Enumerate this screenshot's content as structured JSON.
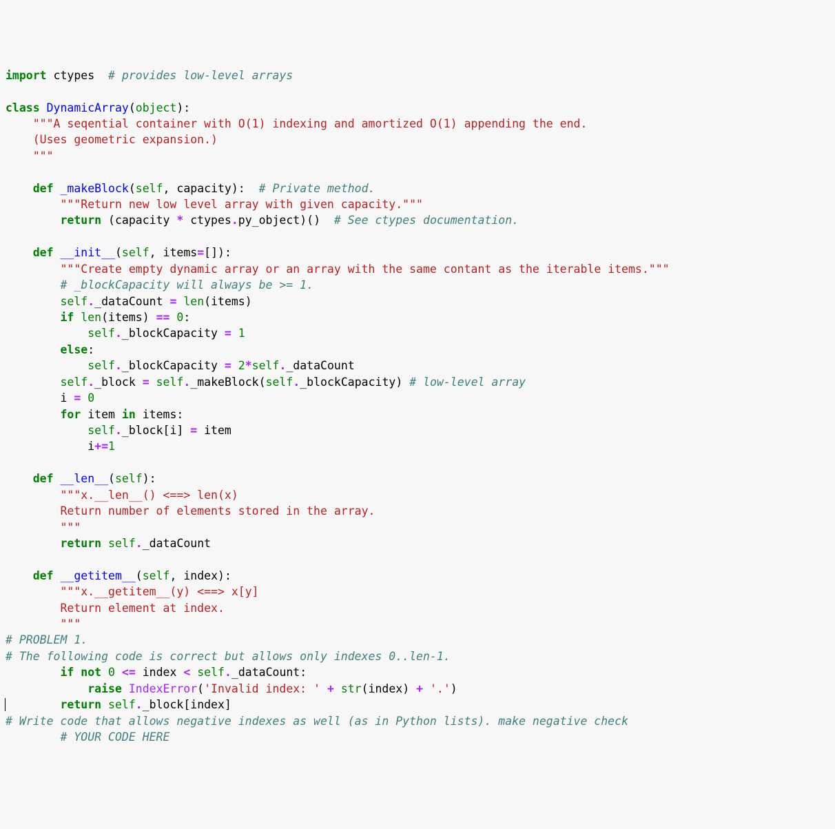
{
  "l1_import": "import",
  "l1_mod": "ctypes",
  "l1_cmt": "# provides low-level arrays",
  "l3_class": "class",
  "l3_name": "DynamicArray",
  "l3_obj": "object",
  "l4_ds": "\"\"\"A seqential container with O(1) indexing and amortized O(1) appending the end.",
  "l5_ds": "(Uses geometric expansion.)",
  "l6_ds": "\"\"\"",
  "l8_def": "def",
  "l8_name": "_makeBlock",
  "l8_self": "self",
  "l8_p": ", capacity):  ",
  "l8_cmt": "# Private method.",
  "l9_ds": "\"\"\"Return new low level array with given capacity.\"\"\"",
  "l10_ret": "return",
  "l10_body": " (capacity ",
  "l10_op": "*",
  "l10_body2": " ctypes",
  "l10_dot": ".",
  "l10_body3": "py_object)()  ",
  "l10_cmt": "# See ctypes documentation.",
  "l12_def": "def",
  "l12_name": "__init__",
  "l12_self": "self",
  "l12_p": ", items",
  "l12_eq": "=",
  "l12_p2": "[]):",
  "l13_ds": "\"\"\"Create empty dynamic array or an array with the same contant as the iterable items.\"\"\"",
  "l14_cmt": "# _blockCapacity will always be >= 1.",
  "l15_self": "self",
  "l15_dot": ".",
  "l15_a": "_dataCount ",
  "l15_eq": "=",
  "l15_sp": " ",
  "l15_len": "len",
  "l15_b": "(items)",
  "l16_if": "if",
  "l16_sp": " ",
  "l16_len": "len",
  "l16_a": "(items) ",
  "l16_eq": "==",
  "l16_sp2": " ",
  "l16_z": "0",
  "l16_c": ":",
  "l17_self": "self",
  "l17_dot": ".",
  "l17_a": "_blockCapacity ",
  "l17_eq": "=",
  "l17_sp": " ",
  "l17_one": "1",
  "l18_else": "else",
  "l18_c": ":",
  "l19_self": "self",
  "l19_dot": ".",
  "l19_a": "_blockCapacity ",
  "l19_eq": "=",
  "l19_sp": " ",
  "l19_two": "2",
  "l19_star": "*",
  "l19_self2": "self",
  "l19_dot2": ".",
  "l19_b": "_dataCount",
  "l20_self": "self",
  "l20_dot": ".",
  "l20_a": "_block ",
  "l20_eq": "=",
  "l20_sp": " ",
  "l20_self2": "self",
  "l20_dot2": ".",
  "l20_b": "_makeBlock(",
  "l20_self3": "self",
  "l20_dot3": ".",
  "l20_c": "_blockCapacity) ",
  "l20_cmt": "# low-level array",
  "l21_a": "i ",
  "l21_eq": "=",
  "l21_sp": " ",
  "l21_z": "0",
  "l22_for": "for",
  "l22_a": " item ",
  "l22_in": "in",
  "l22_b": " items:",
  "l23_self": "self",
  "l23_dot": ".",
  "l23_a": "_block[i] ",
  "l23_eq": "=",
  "l23_b": " item",
  "l24_a": "i",
  "l24_op": "+=",
  "l24_one": "1",
  "l26_def": "def",
  "l26_name": "__len__",
  "l26_self": "self",
  "l26_p": "):",
  "l27_ds": "\"\"\"x.__len__() <==> len(x)",
  "l28_ds": "Return number of elements stored in the array.",
  "l29_ds": "\"\"\"",
  "l30_ret": "return",
  "l30_sp": " ",
  "l30_self": "self",
  "l30_dot": ".",
  "l30_a": "_dataCount",
  "l32_def": "def",
  "l32_name": "__getitem__",
  "l32_self": "self",
  "l32_p": ", index):",
  "l33_ds": "\"\"\"x.__getitem__(y) <==> x[y]",
  "l34_ds": "Return element at index.",
  "l35_ds": "\"\"\"",
  "l36_cmt": "# PROBLEM 1.",
  "l37_cmt": "# The following code is correct but allows only indexes 0..len-1.",
  "l38_if": "if",
  "l38_sp": " ",
  "l38_not": "not",
  "l38_sp2": " ",
  "l38_z": "0",
  "l38_sp3": " ",
  "l38_le": "<=",
  "l38_a": " index ",
  "l38_lt": "<",
  "l38_sp4": " ",
  "l38_self": "self",
  "l38_dot": ".",
  "l38_b": "_dataCount:",
  "l39_raise": "raise",
  "l39_sp": " ",
  "l39_exc": "IndexError",
  "l39_a": "(",
  "l39_s1": "'Invalid index: '",
  "l39_sp2": " ",
  "l39_plus": "+",
  "l39_sp3": " ",
  "l39_str": "str",
  "l39_b": "(index) ",
  "l39_plus2": "+",
  "l39_sp4": " ",
  "l39_s2": "'.'",
  "l39_c": ")",
  "l40_ret": "return",
  "l40_sp": " ",
  "l40_self": "self",
  "l40_dot": ".",
  "l40_a": "_block[index]",
  "l41_cmt": "# Write code that allows negative indexes as well (as in Python lists). make negative check",
  "l42_cmt": "# YOUR CODE HERE"
}
